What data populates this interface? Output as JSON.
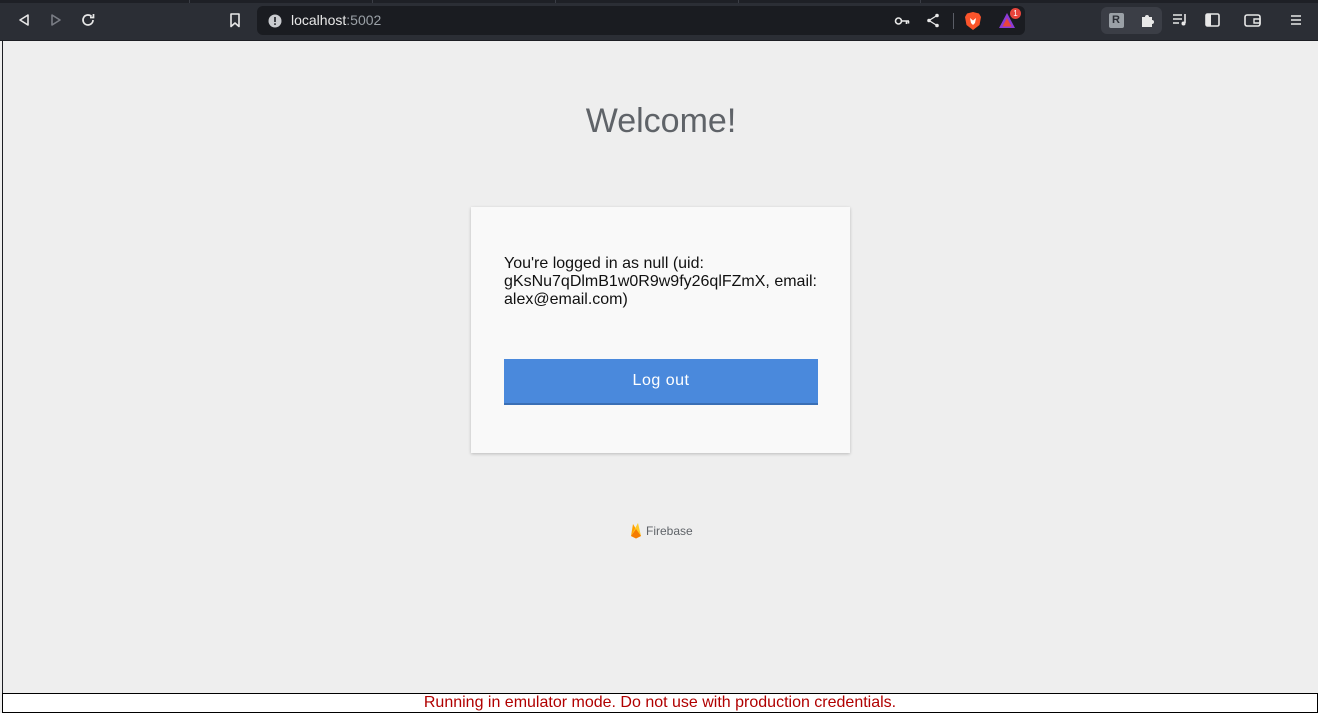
{
  "browser": {
    "url_host": "localhost",
    "url_port": ":5002",
    "shields_badge": "1",
    "ext_letter": "R"
  },
  "page": {
    "heading": "Welcome!",
    "status_message": "You're logged in as null (uid: gKsNu7qDlmB1w0R9w9fy26qlFZmX, email: alex@email.com)",
    "logout_label": "Log out",
    "footer_brand": "Firebase"
  },
  "emulator_banner": "Running in emulator mode. Do not use with production credentials.",
  "colors": {
    "accent": "#4a89dc",
    "warning_text": "#b00000",
    "toolbar_bg": "#2b2e35"
  }
}
